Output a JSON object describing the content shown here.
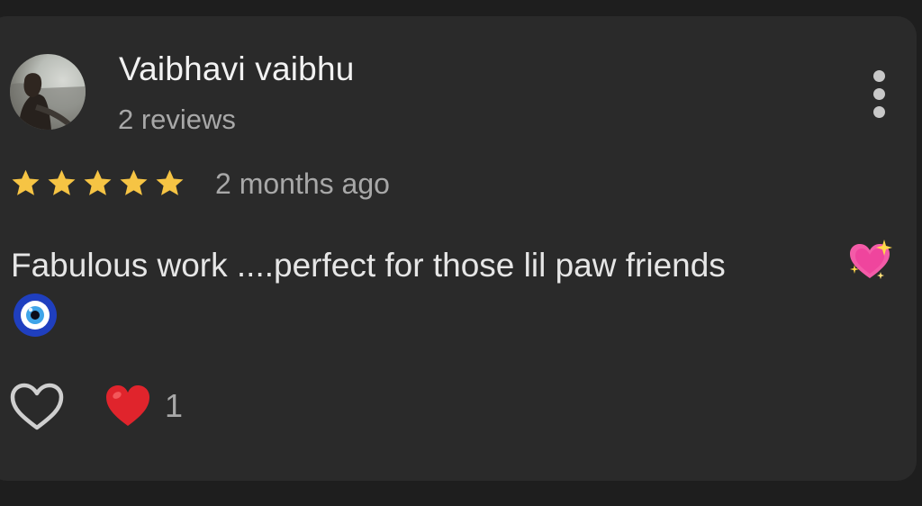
{
  "review": {
    "author_name": "Vaibhavi vaibhu",
    "author_reviews": "2 reviews",
    "rating": 5,
    "rating_max": 5,
    "time_ago": "2 months ago",
    "text": "Fabulous work ....perfect for those lil paw friends",
    "emojis": [
      "sparkling-heart-emoji",
      "evil-eye-emoji"
    ],
    "reaction_count": "1"
  },
  "icons": {
    "more": "more-vert-icon",
    "like": "heart-outline-icon",
    "reaction": "red-heart-emoji",
    "star": "star-icon"
  },
  "colors": {
    "background": "#1e1e1e",
    "card": "#2a2a2a",
    "primary_text": "#f2f2f2",
    "secondary_text": "#a8a8a8",
    "star": "#f6c444",
    "heart_red": "#e0242c",
    "heart_pink": "#f45ba8"
  }
}
